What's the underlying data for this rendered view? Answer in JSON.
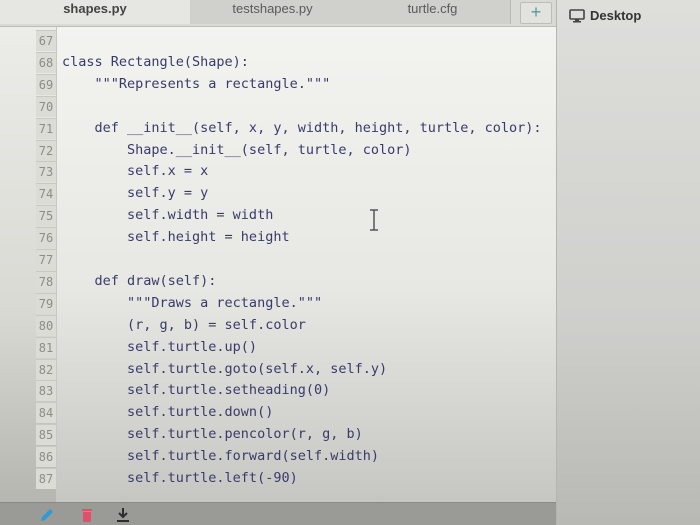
{
  "tabs": [
    {
      "label": "shapes.py",
      "active": true
    },
    {
      "label": "testshapes.py",
      "active": false
    },
    {
      "label": "turtle.cfg",
      "active": false
    }
  ],
  "add_tab_label": "+",
  "sidebar": {
    "desktop_label": "Desktop"
  },
  "editor": {
    "lines": [
      {
        "number": "67",
        "code": ""
      },
      {
        "number": "68",
        "code": "class Rectangle(Shape):"
      },
      {
        "number": "69",
        "code": "    \"\"\"Represents a rectangle.\"\"\""
      },
      {
        "number": "70",
        "code": ""
      },
      {
        "number": "71",
        "code": "    def __init__(self, x, y, width, height, turtle, color):"
      },
      {
        "number": "72",
        "code": "        Shape.__init__(self, turtle, color)"
      },
      {
        "number": "73",
        "code": "        self.x = x"
      },
      {
        "number": "74",
        "code": "        self.y = y"
      },
      {
        "number": "75",
        "code": "        self.width = width"
      },
      {
        "number": "76",
        "code": "        self.height = height"
      },
      {
        "number": "77",
        "code": ""
      },
      {
        "number": "78",
        "code": "    def draw(self):"
      },
      {
        "number": "79",
        "code": "        \"\"\"Draws a rectangle.\"\"\""
      },
      {
        "number": "80",
        "code": "        (r, g, b) = self.color"
      },
      {
        "number": "81",
        "code": "        self.turtle.up()"
      },
      {
        "number": "82",
        "code": "        self.turtle.goto(self.x, self.y)"
      },
      {
        "number": "83",
        "code": "        self.turtle.setheading(0)"
      },
      {
        "number": "84",
        "code": "        self.turtle.down()"
      },
      {
        "number": "85",
        "code": "        self.turtle.pencolor(r, g, b)"
      },
      {
        "number": "86",
        "code": "        self.turtle.forward(self.width)"
      },
      {
        "number": "87",
        "code": "        self.turtle.left(-90)"
      }
    ]
  },
  "toolbar": {
    "icons": [
      "pencil-icon",
      "trash-icon",
      "download-icon"
    ],
    "colors": {
      "pencil": "#2f9bd6",
      "trash": "#e0506a",
      "download": "#2d2d2d"
    }
  }
}
